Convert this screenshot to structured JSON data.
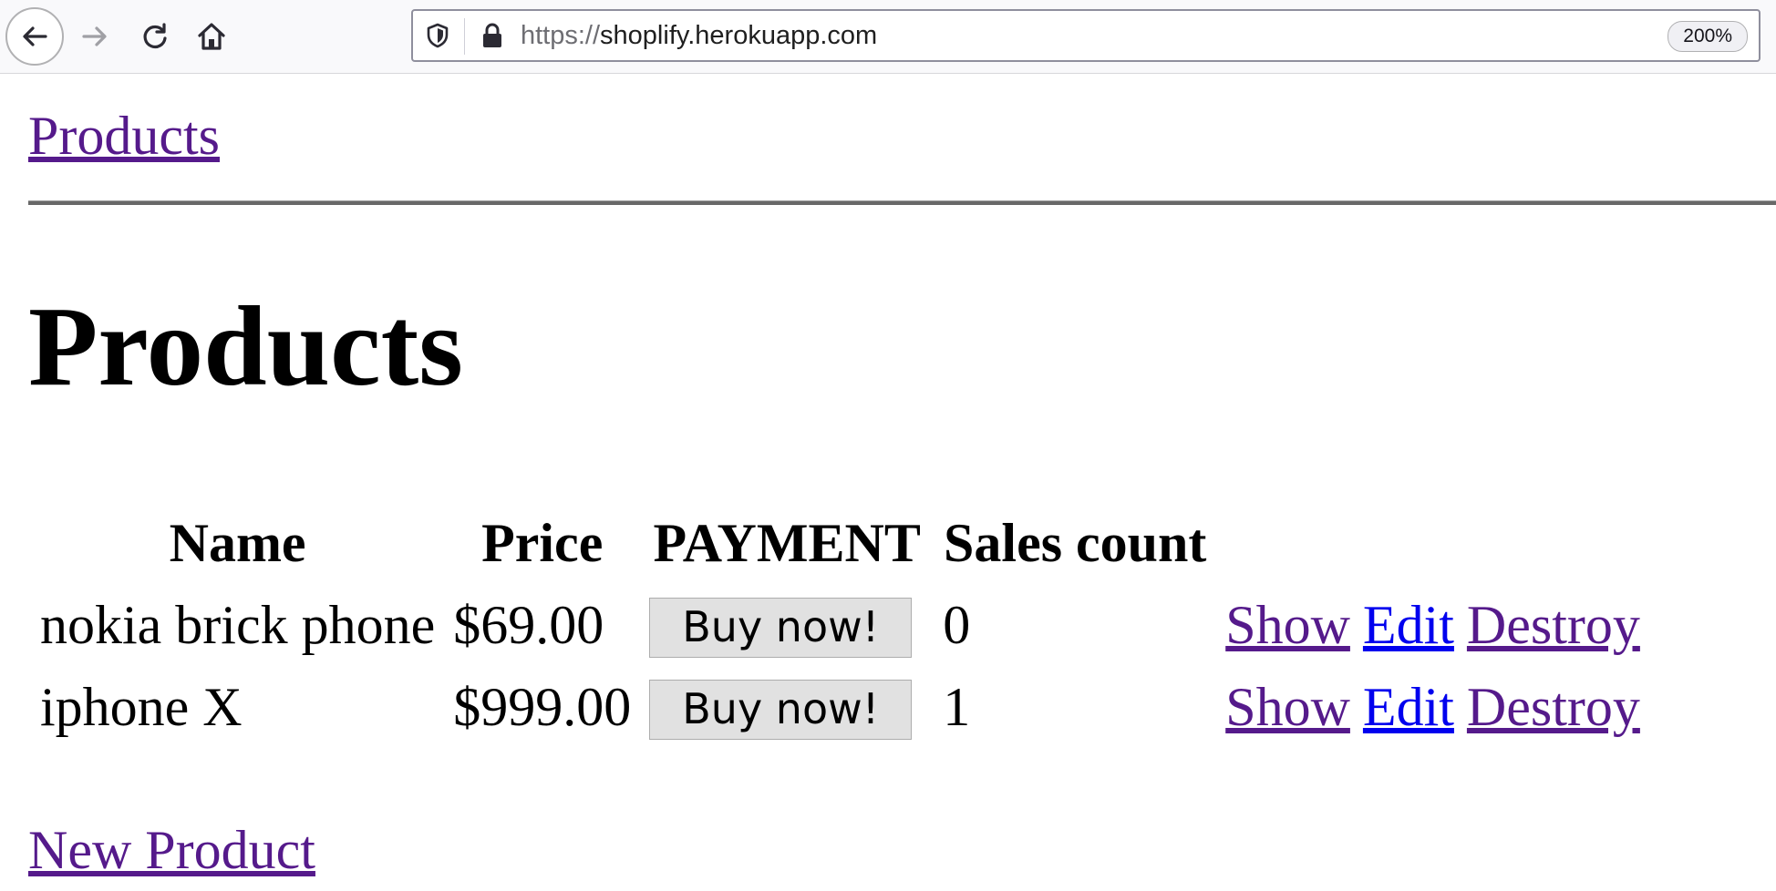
{
  "browser": {
    "url_scheme": "https://",
    "url_host": "shoplify.herokuapp.com",
    "zoom": "200%"
  },
  "page": {
    "nav_link": "Products",
    "heading": "Products",
    "table": {
      "headers": [
        "Name",
        "Price",
        "PAYMENT",
        "Sales count"
      ],
      "rows": [
        {
          "name": "nokia brick phone",
          "price": "$69.00",
          "buy": "Buy now!",
          "sales_count": "0",
          "show": "Show",
          "edit": "Edit",
          "destroy": "Destroy"
        },
        {
          "name": "iphone X",
          "price": "$999.00",
          "buy": "Buy now!",
          "sales_count": "1",
          "show": "Show",
          "edit": "Edit",
          "destroy": "Destroy"
        }
      ]
    },
    "new_link": "New Product"
  },
  "colors": {
    "visited_link": "#551a8b",
    "unvisited_link": "#0000ee",
    "button_bg": "#e1e1e1"
  },
  "icons": [
    "back-arrow-icon",
    "forward-arrow-icon",
    "reload-icon",
    "home-icon",
    "shield-icon",
    "lock-icon"
  ]
}
